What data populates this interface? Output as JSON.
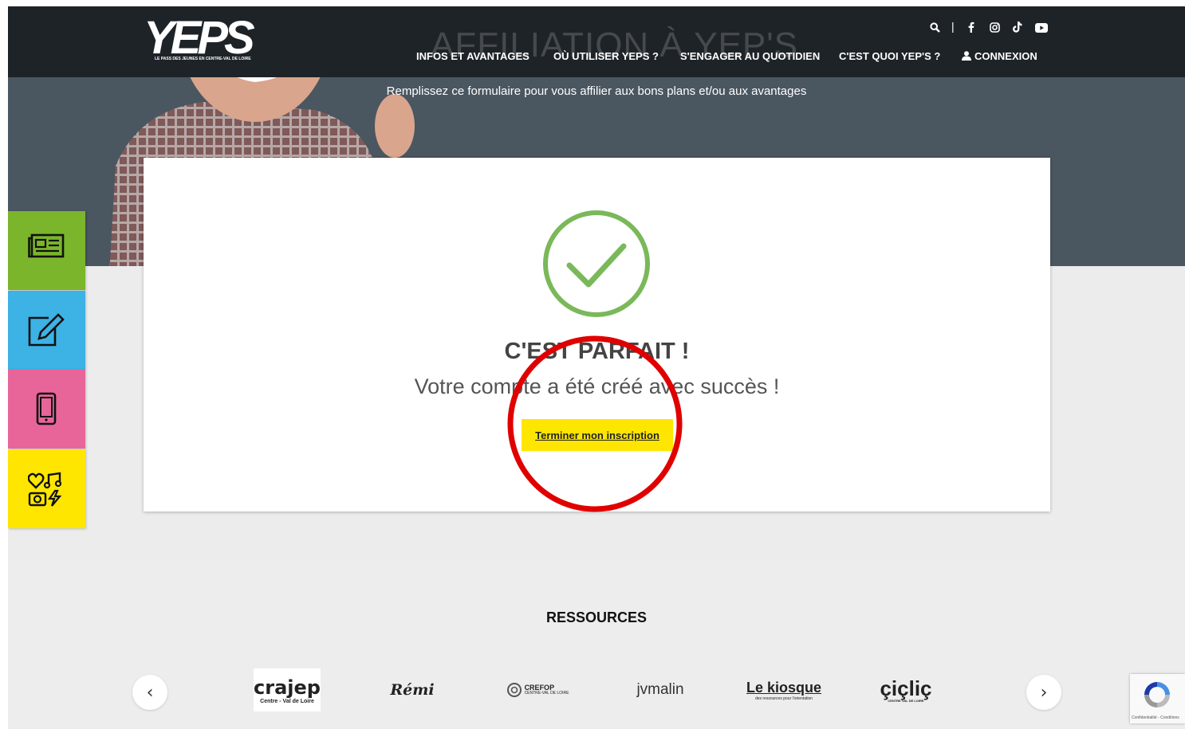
{
  "brand": {
    "logo_text": "YEPS",
    "logo_tagline": "LE PASS DES JEUNES EN CENTRE-VAL DE LOIRE"
  },
  "hero": {
    "title": "AFFILIATION À YEP'S",
    "subtitle": "Remplissez ce formulaire pour vous affilier aux bons plans et/ou aux avantages"
  },
  "nav": {
    "items": [
      "INFOS ET AVANTAGES",
      "OÙ UTILISER YEPS ?",
      "S'ENGAGER AU QUOTIDIEN",
      "C'EST QUOI YEP'S ?"
    ],
    "login": "CONNEXION",
    "social_icons": [
      "search-icon",
      "facebook-icon",
      "instagram-icon",
      "tiktok-icon",
      "youtube-icon"
    ],
    "separator": "|"
  },
  "sidebar": {
    "items": [
      {
        "icon": "newspaper-icon",
        "color": "#7ab52b"
      },
      {
        "icon": "edit-icon",
        "color": "#3cb2e5"
      },
      {
        "icon": "phone-icon",
        "color": "#e8659a"
      },
      {
        "icon": "leisure-icon",
        "color": "#ffe600"
      }
    ]
  },
  "success": {
    "title": "C'EST PARFAIT !",
    "message": "Votre compte a été créé avec succès !",
    "button": "Terminer mon inscription",
    "check_color": "#7ab85a"
  },
  "resources": {
    "title": "RESSOURCES",
    "logos": [
      "crajep",
      "Rémi",
      "CREFOP",
      "jvmalin",
      "Le kiosque",
      "çiçliç"
    ],
    "logo_captions": {
      "crajep": "Centre - Val de Loire",
      "kiosque": "des ressources pour l'orientation",
      "ciclic": "CENTRE VAL DE LOIRE",
      "crefop": "CENTRE-VAL DE LOIRE"
    },
    "prev": "‹",
    "next": "›"
  },
  "recaptcha": {
    "footer": "Confidentialité - Conditions"
  },
  "colors": {
    "accent_yellow": "#ffe600",
    "annotation_red": "#e00000",
    "topbar": "#1e2328"
  }
}
